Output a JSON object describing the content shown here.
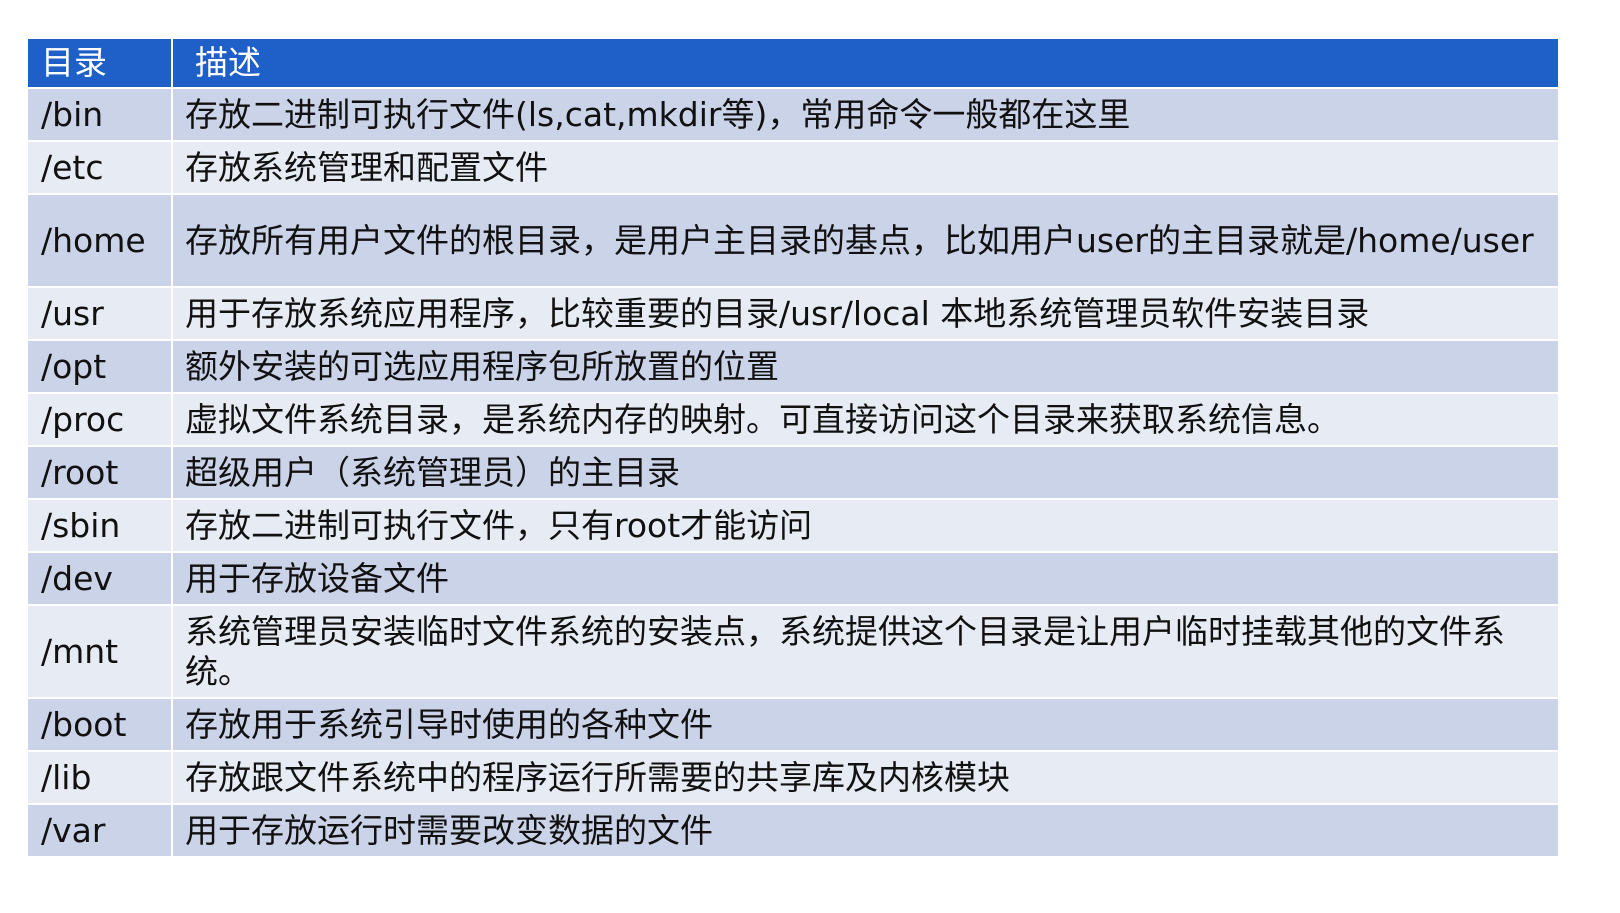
{
  "table": {
    "headers": [
      "目录",
      "描述"
    ],
    "rows": [
      {
        "dir": "/bin",
        "desc": "存放二进制可执行文件(ls,cat,mkdir等)，常用命令一般都在这里"
      },
      {
        "dir": "/etc",
        "desc": "存放系统管理和配置文件"
      },
      {
        "dir": "/home",
        "desc": "存放所有用户文件的根目录，是用户主目录的基点，比如用户user的主目录就是/home/user"
      },
      {
        "dir": "/usr",
        "desc": "用于存放系统应用程序，比较重要的目录/usr/local 本地系统管理员软件安装目录"
      },
      {
        "dir": "/opt",
        "desc": "额外安装的可选应用程序包所放置的位置"
      },
      {
        "dir": "/proc",
        "desc": "虚拟文件系统目录，是系统内存的映射。可直接访问这个目录来获取系统信息。"
      },
      {
        "dir": "/root",
        "desc": "超级用户（系统管理员）的主目录"
      },
      {
        "dir": "/sbin",
        "desc": "存放二进制可执行文件，只有root才能访问"
      },
      {
        "dir": "/dev",
        "desc": "用于存放设备文件"
      },
      {
        "dir": "/mnt",
        "desc": "系统管理员安装临时文件系统的安装点，系统提供这个目录是让用户临时挂载其他的文件系统。"
      },
      {
        "dir": "/boot",
        "desc": "存放用于系统引导时使用的各种文件"
      },
      {
        "dir": "/lib",
        "desc": "存放跟文件系统中的程序运行所需要的共享库及内核模块"
      },
      {
        "dir": "/var",
        "desc": "用于存放运行时需要改变数据的文件"
      }
    ]
  },
  "colors": {
    "header_bg": "#1f5fc8",
    "row_odd_bg": "#cbd3e8",
    "row_even_bg": "#e7ebf4"
  }
}
